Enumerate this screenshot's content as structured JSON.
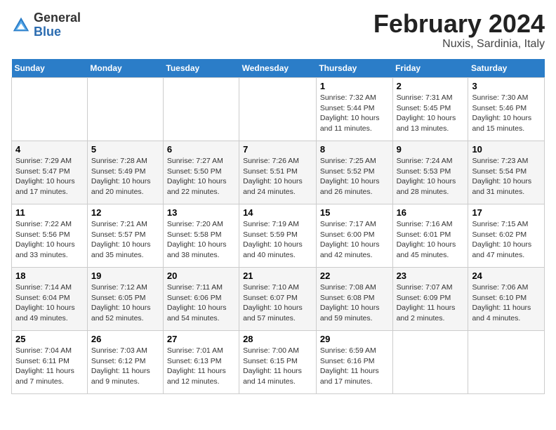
{
  "header": {
    "logo_general": "General",
    "logo_blue": "Blue",
    "month": "February 2024",
    "location": "Nuxis, Sardinia, Italy"
  },
  "days_of_week": [
    "Sunday",
    "Monday",
    "Tuesday",
    "Wednesday",
    "Thursday",
    "Friday",
    "Saturday"
  ],
  "weeks": [
    [
      {
        "day": "",
        "info": ""
      },
      {
        "day": "",
        "info": ""
      },
      {
        "day": "",
        "info": ""
      },
      {
        "day": "",
        "info": ""
      },
      {
        "day": "1",
        "info": "Sunrise: 7:32 AM\nSunset: 5:44 PM\nDaylight: 10 hours and 11 minutes."
      },
      {
        "day": "2",
        "info": "Sunrise: 7:31 AM\nSunset: 5:45 PM\nDaylight: 10 hours and 13 minutes."
      },
      {
        "day": "3",
        "info": "Sunrise: 7:30 AM\nSunset: 5:46 PM\nDaylight: 10 hours and 15 minutes."
      }
    ],
    [
      {
        "day": "4",
        "info": "Sunrise: 7:29 AM\nSunset: 5:47 PM\nDaylight: 10 hours and 17 minutes."
      },
      {
        "day": "5",
        "info": "Sunrise: 7:28 AM\nSunset: 5:49 PM\nDaylight: 10 hours and 20 minutes."
      },
      {
        "day": "6",
        "info": "Sunrise: 7:27 AM\nSunset: 5:50 PM\nDaylight: 10 hours and 22 minutes."
      },
      {
        "day": "7",
        "info": "Sunrise: 7:26 AM\nSunset: 5:51 PM\nDaylight: 10 hours and 24 minutes."
      },
      {
        "day": "8",
        "info": "Sunrise: 7:25 AM\nSunset: 5:52 PM\nDaylight: 10 hours and 26 minutes."
      },
      {
        "day": "9",
        "info": "Sunrise: 7:24 AM\nSunset: 5:53 PM\nDaylight: 10 hours and 28 minutes."
      },
      {
        "day": "10",
        "info": "Sunrise: 7:23 AM\nSunset: 5:54 PM\nDaylight: 10 hours and 31 minutes."
      }
    ],
    [
      {
        "day": "11",
        "info": "Sunrise: 7:22 AM\nSunset: 5:56 PM\nDaylight: 10 hours and 33 minutes."
      },
      {
        "day": "12",
        "info": "Sunrise: 7:21 AM\nSunset: 5:57 PM\nDaylight: 10 hours and 35 minutes."
      },
      {
        "day": "13",
        "info": "Sunrise: 7:20 AM\nSunset: 5:58 PM\nDaylight: 10 hours and 38 minutes."
      },
      {
        "day": "14",
        "info": "Sunrise: 7:19 AM\nSunset: 5:59 PM\nDaylight: 10 hours and 40 minutes."
      },
      {
        "day": "15",
        "info": "Sunrise: 7:17 AM\nSunset: 6:00 PM\nDaylight: 10 hours and 42 minutes."
      },
      {
        "day": "16",
        "info": "Sunrise: 7:16 AM\nSunset: 6:01 PM\nDaylight: 10 hours and 45 minutes."
      },
      {
        "day": "17",
        "info": "Sunrise: 7:15 AM\nSunset: 6:02 PM\nDaylight: 10 hours and 47 minutes."
      }
    ],
    [
      {
        "day": "18",
        "info": "Sunrise: 7:14 AM\nSunset: 6:04 PM\nDaylight: 10 hours and 49 minutes."
      },
      {
        "day": "19",
        "info": "Sunrise: 7:12 AM\nSunset: 6:05 PM\nDaylight: 10 hours and 52 minutes."
      },
      {
        "day": "20",
        "info": "Sunrise: 7:11 AM\nSunset: 6:06 PM\nDaylight: 10 hours and 54 minutes."
      },
      {
        "day": "21",
        "info": "Sunrise: 7:10 AM\nSunset: 6:07 PM\nDaylight: 10 hours and 57 minutes."
      },
      {
        "day": "22",
        "info": "Sunrise: 7:08 AM\nSunset: 6:08 PM\nDaylight: 10 hours and 59 minutes."
      },
      {
        "day": "23",
        "info": "Sunrise: 7:07 AM\nSunset: 6:09 PM\nDaylight: 11 hours and 2 minutes."
      },
      {
        "day": "24",
        "info": "Sunrise: 7:06 AM\nSunset: 6:10 PM\nDaylight: 11 hours and 4 minutes."
      }
    ],
    [
      {
        "day": "25",
        "info": "Sunrise: 7:04 AM\nSunset: 6:11 PM\nDaylight: 11 hours and 7 minutes."
      },
      {
        "day": "26",
        "info": "Sunrise: 7:03 AM\nSunset: 6:12 PM\nDaylight: 11 hours and 9 minutes."
      },
      {
        "day": "27",
        "info": "Sunrise: 7:01 AM\nSunset: 6:13 PM\nDaylight: 11 hours and 12 minutes."
      },
      {
        "day": "28",
        "info": "Sunrise: 7:00 AM\nSunset: 6:15 PM\nDaylight: 11 hours and 14 minutes."
      },
      {
        "day": "29",
        "info": "Sunrise: 6:59 AM\nSunset: 6:16 PM\nDaylight: 11 hours and 17 minutes."
      },
      {
        "day": "",
        "info": ""
      },
      {
        "day": "",
        "info": ""
      }
    ]
  ]
}
